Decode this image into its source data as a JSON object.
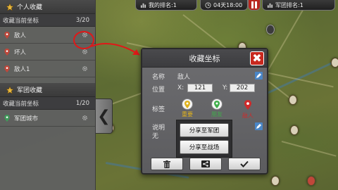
{
  "topbar": {
    "my_rank": "我的排名:1",
    "date": "04天18:00",
    "legion_rank": "军团排名:1"
  },
  "personal": {
    "header": "个人收藏",
    "sub_label": "收藏当前坐标",
    "count": "3/20",
    "items": [
      {
        "label": "敌人",
        "pin_color": "#c0473a"
      },
      {
        "label": "坏人",
        "pin_color": "#c0473a"
      },
      {
        "label": "敌人1",
        "pin_color": "#c0473a"
      }
    ]
  },
  "legion": {
    "header": "军团收藏",
    "sub_label": "收藏当前坐标",
    "count": "1/20",
    "items": [
      {
        "label": "军团城市",
        "pin_color": "#3f9b5a"
      }
    ]
  },
  "collapse_glyph": "❮",
  "dialog": {
    "title": "收藏坐标",
    "close_glyph": "✖",
    "name_label": "名称",
    "name_value": "敌人",
    "position_label": "位置",
    "x_label": "X:",
    "x_value": "121",
    "y_label": "Y:",
    "y_value": "202",
    "tag_label": "标签",
    "tags": [
      {
        "label": "重要",
        "color": "#e0b21c"
      },
      {
        "label": "朋友",
        "color": "#3fae4a"
      },
      {
        "label": "敌人",
        "color": "#d02a2a"
      }
    ],
    "desc_label": "说明",
    "desc_value": "无"
  },
  "share": {
    "to_legion": "分享至军团",
    "to_battlefield": "分享至战场"
  },
  "colors": {
    "annotation_red": "#e01818",
    "close_red": "#c8281e"
  }
}
